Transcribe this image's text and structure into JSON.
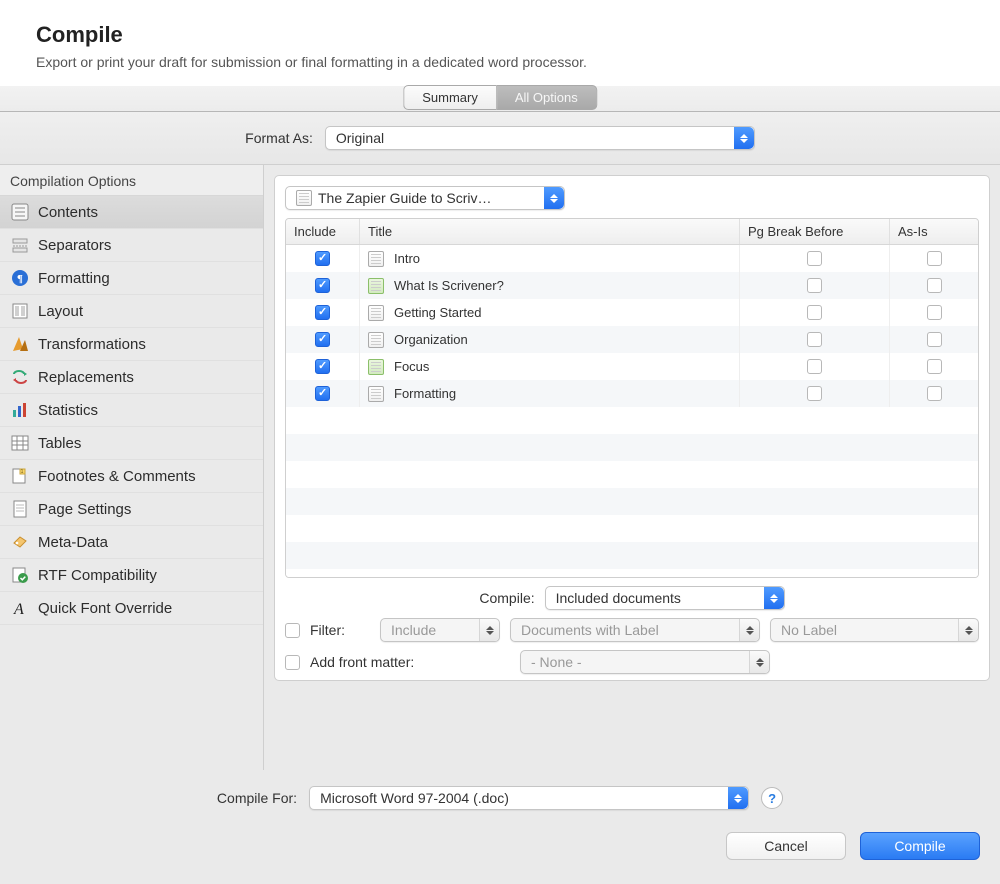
{
  "header": {
    "title": "Compile",
    "subtitle": "Export or print your draft for submission or final formatting in a dedicated word processor."
  },
  "tabs": {
    "summary": "Summary",
    "all_options": "All Options"
  },
  "format": {
    "label": "Format As:",
    "value": "Original"
  },
  "sidebar": {
    "header": "Compilation Options",
    "items": [
      {
        "name": "contents",
        "label": "Contents"
      },
      {
        "name": "separators",
        "label": "Separators"
      },
      {
        "name": "formatting",
        "label": "Formatting"
      },
      {
        "name": "layout",
        "label": "Layout"
      },
      {
        "name": "transformations",
        "label": "Transformations"
      },
      {
        "name": "replacements",
        "label": "Replacements"
      },
      {
        "name": "statistics",
        "label": "Statistics"
      },
      {
        "name": "tables",
        "label": "Tables"
      },
      {
        "name": "footnotes",
        "label": "Footnotes & Comments"
      },
      {
        "name": "page-settings",
        "label": "Page Settings"
      },
      {
        "name": "meta-data",
        "label": "Meta-Data"
      },
      {
        "name": "rtf-compat",
        "label": "RTF Compatibility"
      },
      {
        "name": "font-override",
        "label": "Quick Font Override"
      }
    ]
  },
  "source": {
    "value": "The Zapier Guide to Scriv…"
  },
  "columns": {
    "include": "Include",
    "title": "Title",
    "pgbreak": "Pg Break Before",
    "asis": "As-Is"
  },
  "docs": [
    {
      "title": "Intro",
      "folder": false,
      "include": true,
      "pgbreak": false,
      "asis": false
    },
    {
      "title": "What Is Scrivener?",
      "folder": true,
      "include": true,
      "pgbreak": false,
      "asis": false
    },
    {
      "title": "Getting Started",
      "folder": false,
      "include": true,
      "pgbreak": false,
      "asis": false
    },
    {
      "title": "Organization",
      "folder": false,
      "include": true,
      "pgbreak": false,
      "asis": false
    },
    {
      "title": "Focus",
      "folder": true,
      "include": true,
      "pgbreak": false,
      "asis": false
    },
    {
      "title": "Formatting",
      "folder": false,
      "include": true,
      "pgbreak": false,
      "asis": false
    }
  ],
  "compile_filter": {
    "label": "Compile:",
    "value": "Included documents"
  },
  "filter": {
    "label": "Filter:",
    "mode": "Include",
    "criterion": "Documents with Label",
    "value": "No Label"
  },
  "front_matter": {
    "label": "Add front matter:",
    "value": "- None -"
  },
  "compile_for": {
    "label": "Compile For:",
    "value": "Microsoft Word 97-2004 (.doc)"
  },
  "buttons": {
    "cancel": "Cancel",
    "compile": "Compile"
  },
  "help": "?"
}
